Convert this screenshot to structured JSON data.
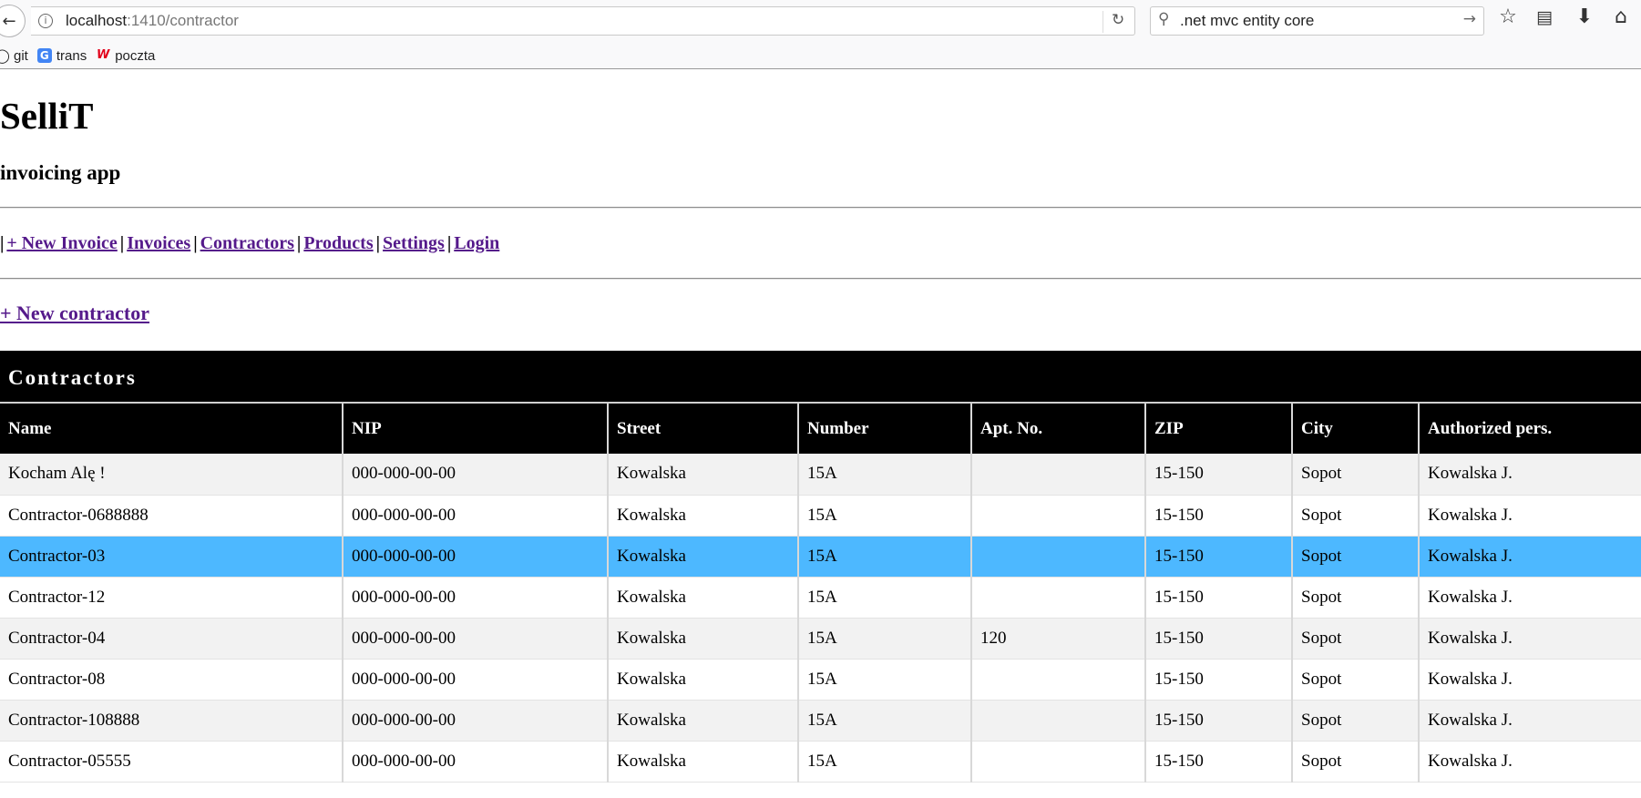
{
  "browser": {
    "url_host": "localhost",
    "url_path": ":1410/contractor",
    "search_value": ".net mvc entity core",
    "bookmarks": [
      {
        "label": "git",
        "icon": "github-icon"
      },
      {
        "label": "trans",
        "icon": "translate-icon"
      },
      {
        "label": "poczta",
        "icon": "wp-mail-icon"
      }
    ]
  },
  "site": {
    "title": "SelliT",
    "subtitle": "invoicing app"
  },
  "menu": {
    "leading_pipe": "|",
    "items": [
      "+ New Invoice",
      "Invoices",
      "Contractors",
      "Products",
      "Settings",
      "Login"
    ]
  },
  "new_contractor_label": "+ New contractor",
  "table": {
    "caption": "Contractors",
    "columns": [
      "Name",
      "NIP",
      "Street",
      "Number",
      "Apt. No.",
      "ZIP",
      "City",
      "Authorized pers."
    ],
    "rows": [
      [
        "Kocham Alę !",
        "000-000-00-00",
        "Kowalska",
        "15A",
        "",
        "15-150",
        "Sopot",
        "Kowalska J."
      ],
      [
        "Contractor-0688888",
        "000-000-00-00",
        "Kowalska",
        "15A",
        "",
        "15-150",
        "Sopot",
        "Kowalska J."
      ],
      [
        "Contractor-03",
        "000-000-00-00",
        "Kowalska",
        "15A",
        "",
        "15-150",
        "Sopot",
        "Kowalska J."
      ],
      [
        "Contractor-12",
        "000-000-00-00",
        "Kowalska",
        "15A",
        "",
        "15-150",
        "Sopot",
        "Kowalska J."
      ],
      [
        "Contractor-04",
        "000-000-00-00",
        "Kowalska",
        "15A",
        "120",
        "15-150",
        "Sopot",
        "Kowalska J."
      ],
      [
        "Contractor-08",
        "000-000-00-00",
        "Kowalska",
        "15A",
        "",
        "15-150",
        "Sopot",
        "Kowalska J."
      ],
      [
        "Contractor-108888",
        "000-000-00-00",
        "Kowalska",
        "15A",
        "",
        "15-150",
        "Sopot",
        "Kowalska J."
      ],
      [
        "Contractor-05555",
        "000-000-00-00",
        "Kowalska",
        "15A",
        "",
        "15-150",
        "Sopot",
        "Kowalska J."
      ]
    ],
    "selected_row": 2
  },
  "colors": {
    "link_visited": "#551a8b",
    "selected_row": "#4db8ff",
    "header_bg": "#000000",
    "odd_row": "#f2f2f2"
  }
}
